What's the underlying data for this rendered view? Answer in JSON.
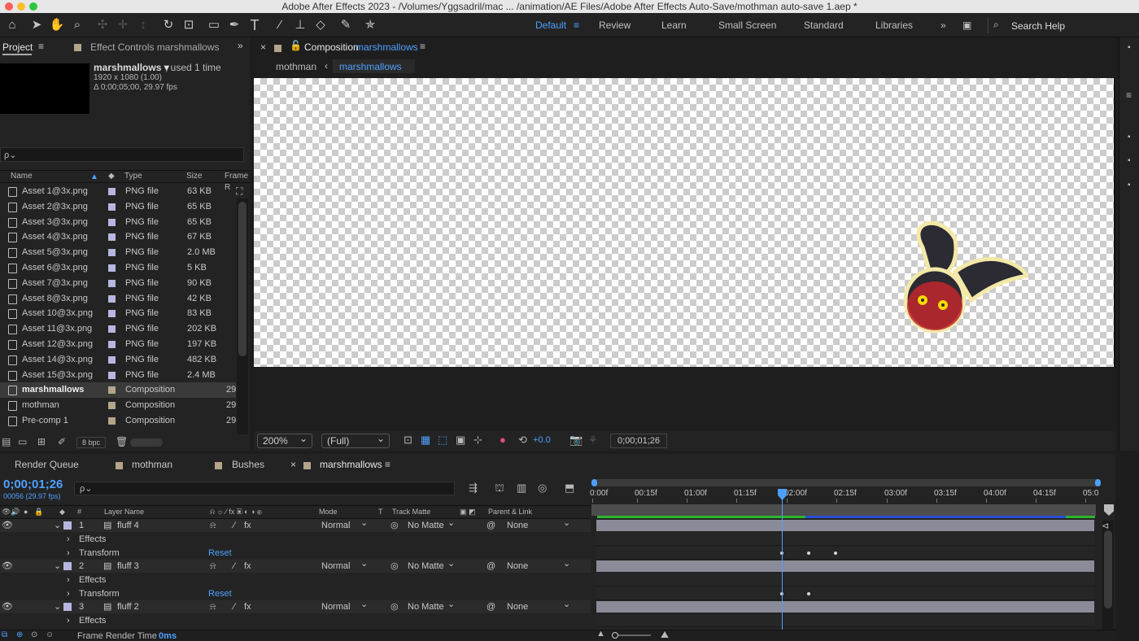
{
  "window": {
    "title": "Adobe After Effects 2023 - /Volumes/Yggsadril/mac ... /animation/AE Files/Adobe After Effects Auto-Save/mothman auto-save 1.aep *"
  },
  "workspaces": {
    "items": [
      "Default",
      "Review",
      "Learn",
      "Small Screen",
      "Standard",
      "Libraries"
    ],
    "active": "Default",
    "search_placeholder": "Search Help"
  },
  "project": {
    "tab": "Project",
    "effects_tab": "Effect Controls marshmallows",
    "selected_name": "marshmallows ▾",
    "used": ", used 1 time",
    "res": "1920 x 1080 (1.00)",
    "dur": "Δ 0;00;05;00, 29.97 fps",
    "search_placeholder": "ρ⌄",
    "columns": {
      "name": "Name",
      "type": "Type",
      "size": "Size",
      "frame": "Frame R"
    },
    "rows": [
      {
        "name": "Asset 1@3x.png",
        "type": "PNG file",
        "size": "63 KB",
        "frame": ""
      },
      {
        "name": "Asset 2@3x.png",
        "type": "PNG file",
        "size": "65 KB",
        "frame": ""
      },
      {
        "name": "Asset 3@3x.png",
        "type": "PNG file",
        "size": "65 KB",
        "frame": ""
      },
      {
        "name": "Asset 4@3x.png",
        "type": "PNG file",
        "size": "67 KB",
        "frame": ""
      },
      {
        "name": "Asset 5@3x.png",
        "type": "PNG file",
        "size": "2.0 MB",
        "frame": ""
      },
      {
        "name": "Asset 6@3x.png",
        "type": "PNG file",
        "size": "5 KB",
        "frame": ""
      },
      {
        "name": "Asset 7@3x.png",
        "type": "PNG file",
        "size": "90 KB",
        "frame": ""
      },
      {
        "name": "Asset 8@3x.png",
        "type": "PNG file",
        "size": "42 KB",
        "frame": ""
      },
      {
        "name": "Asset 10@3x.png",
        "type": "PNG file",
        "size": "83 KB",
        "frame": ""
      },
      {
        "name": "Asset 11@3x.png",
        "type": "PNG file",
        "size": "202 KB",
        "frame": ""
      },
      {
        "name": "Asset 12@3x.png",
        "type": "PNG file",
        "size": "197 KB",
        "frame": ""
      },
      {
        "name": "Asset 14@3x.png",
        "type": "PNG file",
        "size": "482 KB",
        "frame": ""
      },
      {
        "name": "Asset 15@3x.png",
        "type": "PNG file",
        "size": "2.4 MB",
        "frame": ""
      },
      {
        "name": "marshmallows",
        "type": "Composition",
        "size": "",
        "frame": "29",
        "selected": true
      },
      {
        "name": "mothman",
        "type": "Composition",
        "size": "",
        "frame": "29"
      },
      {
        "name": "Pre-comp 1",
        "type": "Composition",
        "size": "",
        "frame": "29"
      }
    ],
    "bpc": "8 bpc"
  },
  "composition": {
    "tab_prefix": "Composition",
    "tab_name": "marshmallows",
    "breadcrumbs": [
      "mothman",
      "marshmallows"
    ],
    "zoom": "200%",
    "resolution": "(Full)",
    "exposure": "+0.0",
    "timecode": "0;00;01;26"
  },
  "timeline": {
    "tabs": [
      "Render Queue",
      "mothman",
      "Bushes",
      "marshmallows"
    ],
    "timecode": "0;00;01;26",
    "frames": "00056 (29.97 fps)",
    "search_placeholder": "ρ⌄",
    "columns": {
      "num": "#",
      "layer_name": "Layer Name",
      "mode": "Mode",
      "t": "T",
      "track_matte": "Track Matte",
      "parent": "Parent & Link"
    },
    "ruler": [
      "0:00f",
      "00:15f",
      "01:00f",
      "01:15f",
      "02:00f",
      "02:15f",
      "03:00f",
      "03:15f",
      "04:00f",
      "04:15f",
      "05:0"
    ],
    "layers": [
      {
        "num": "1",
        "name": "fluff 4",
        "mode": "Normal",
        "matte": "No Matte",
        "parent": "None"
      },
      {
        "num": "2",
        "name": "fluff 3",
        "mode": "Normal",
        "matte": "No Matte",
        "parent": "None"
      },
      {
        "num": "3",
        "name": "fluff 2",
        "mode": "Normal",
        "matte": "No Matte",
        "parent": "None"
      }
    ],
    "effects_label": "Effects",
    "transform_label": "Transform",
    "reset_label": "Reset",
    "render_time_label": "Frame Render Time",
    "render_time_value": "0ms"
  }
}
